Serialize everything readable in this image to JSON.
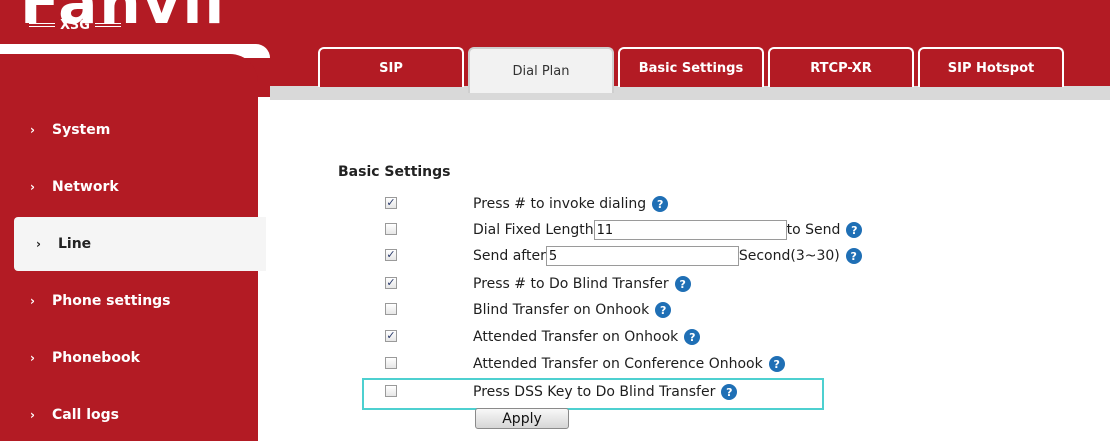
{
  "brand": {
    "logo_text": "Fanvil",
    "model": "X3G"
  },
  "sidebar": {
    "items": [
      {
        "label": "System",
        "arrow": "›"
      },
      {
        "label": "Network",
        "arrow": "›"
      },
      {
        "label": "Line",
        "arrow": "›",
        "active": true
      },
      {
        "label": "Phone settings",
        "arrow": "›"
      },
      {
        "label": "Phonebook",
        "arrow": "›"
      },
      {
        "label": "Call logs",
        "arrow": "›"
      }
    ]
  },
  "tabs": [
    {
      "label": "SIP"
    },
    {
      "label": "Dial Plan",
      "active": true
    },
    {
      "label": "Basic Settings"
    },
    {
      "label": "RTCP-XR"
    },
    {
      "label": "SIP Hotspot"
    }
  ],
  "section": {
    "title": "Basic Settings"
  },
  "settings": [
    {
      "label": "Press # to invoke dialing",
      "checked": true
    },
    {
      "label": "Dial Fixed Length",
      "checked": false,
      "input_value": "11",
      "suffix": "to Send"
    },
    {
      "label": "Send after",
      "checked": true,
      "input_value": "5",
      "suffix": "Second(3~30)"
    },
    {
      "label": "Press # to Do Blind Transfer",
      "checked": true
    },
    {
      "label": "Blind Transfer on Onhook",
      "checked": false
    },
    {
      "label": "Attended Transfer on Onhook",
      "checked": true
    },
    {
      "label": "Attended Transfer on Conference Onhook",
      "checked": false
    },
    {
      "label": "Press DSS Key to Do Blind Transfer",
      "checked": false
    }
  ],
  "apply_label": "Apply",
  "help_glyph": "?",
  "check_glyph": "✓",
  "colors": {
    "brand_red": "#b31b24",
    "highlight": "#4dd0d0",
    "help_blue": "#1f6fb5"
  }
}
